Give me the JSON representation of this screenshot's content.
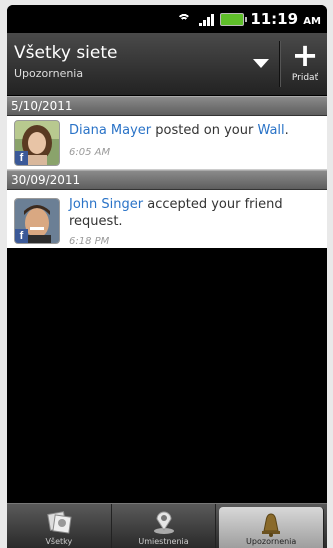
{
  "status_bar": {
    "time": "11:19",
    "ampm": "AM"
  },
  "header": {
    "title": "Všetky siete",
    "subtitle": "Upozornenia",
    "add_label": "Pridať"
  },
  "notifications": [
    {
      "date": "5/10/2011",
      "name": "Diana Mayer",
      "action": " posted on your ",
      "target": "Wall",
      "suffix": ".",
      "time": "6:05 AM",
      "avatar": "woman-photo"
    },
    {
      "date": "30/09/2011",
      "name": "John Singer",
      "action": " accepted your friend request.",
      "target": "",
      "suffix": "",
      "time": "6:18 PM",
      "avatar": "man-photo"
    }
  ],
  "tabs": [
    {
      "label": "Všetky",
      "icon": "photos-icon",
      "active": false
    },
    {
      "label": "Umiestnenia",
      "icon": "location-pin-icon",
      "active": false
    },
    {
      "label": "Upozornenia",
      "icon": "bell-icon",
      "active": true
    }
  ],
  "colors": {
    "link": "#2a73c7",
    "facebook": "#3b5998",
    "battery": "#5fbf2a"
  }
}
